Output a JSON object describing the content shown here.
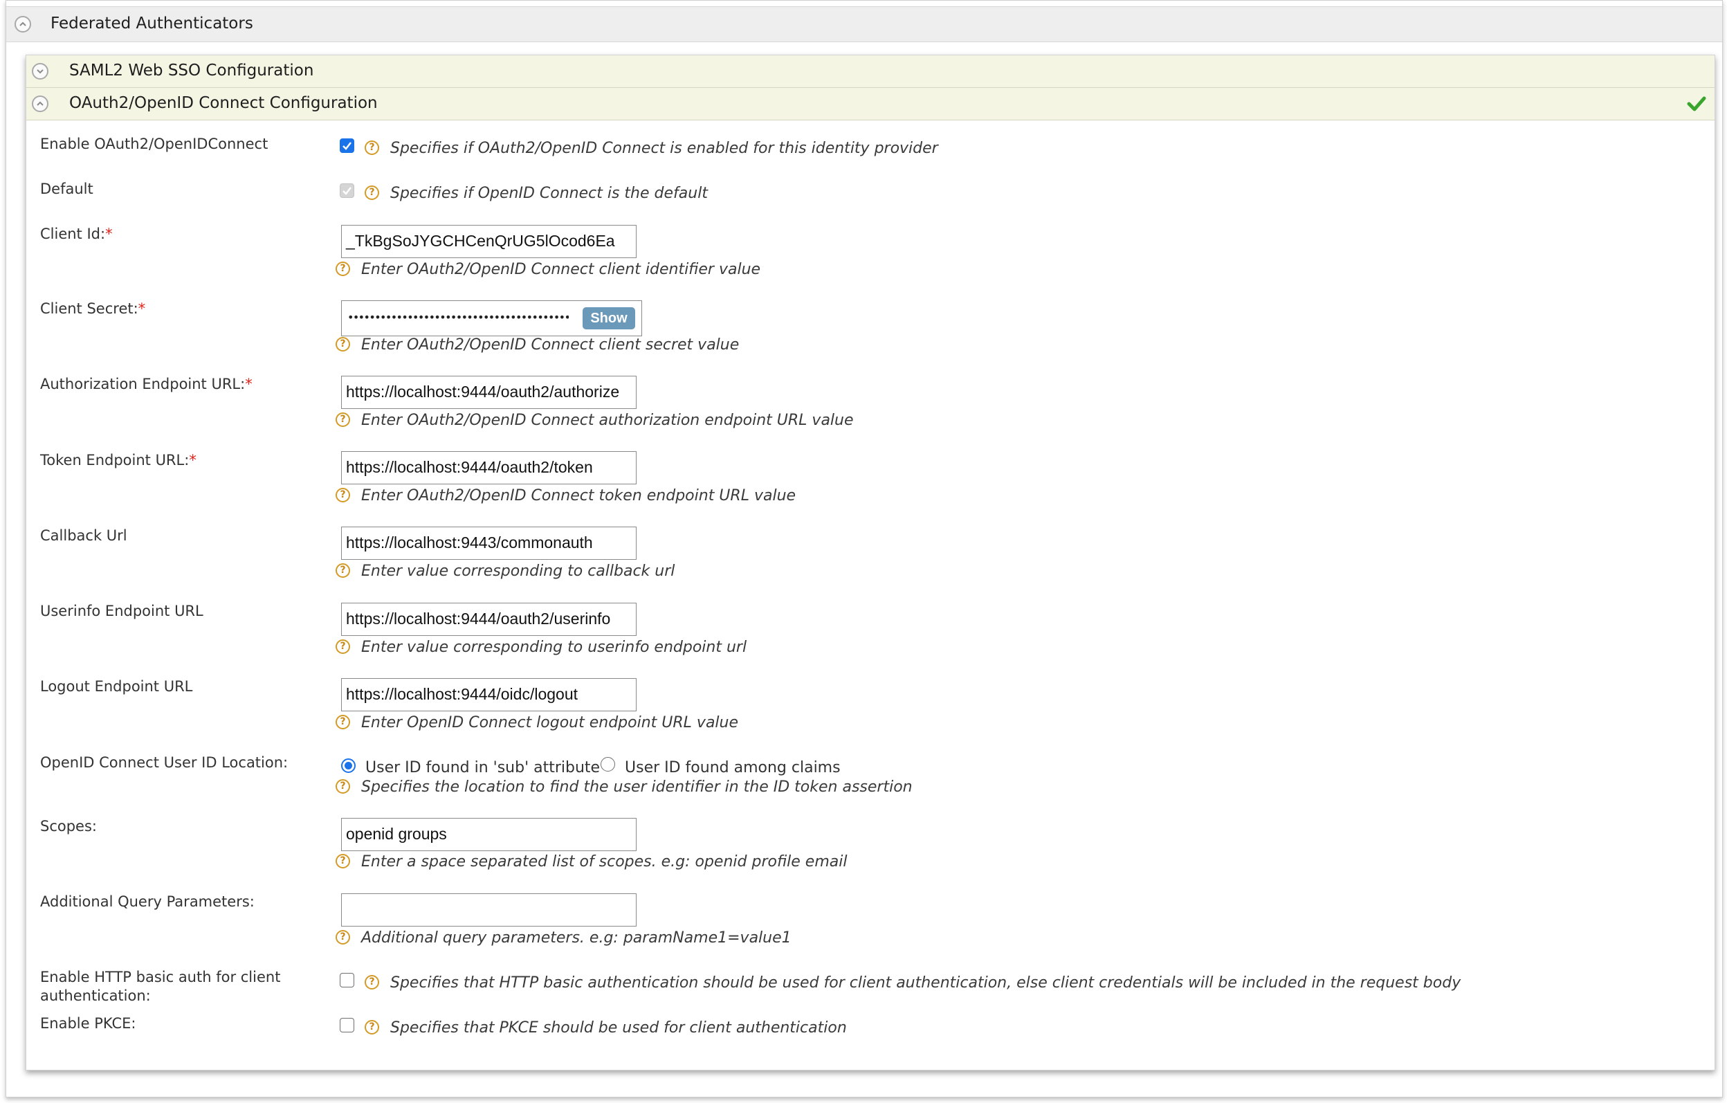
{
  "section": {
    "title": "Federated Authenticators"
  },
  "subsections": {
    "saml": {
      "title": "SAML2 Web SSO Configuration"
    },
    "oidc": {
      "title": "OAuth2/OpenID Connect Configuration"
    }
  },
  "fields": {
    "enable": {
      "label": "Enable OAuth2/OpenIDConnect",
      "checked": true,
      "help": "Specifies if OAuth2/OpenID Connect is enabled for this identity provider"
    },
    "default": {
      "label": "Default",
      "checked": true,
      "disabled": true,
      "help": "Specifies if OpenID Connect is the default"
    },
    "client_id": {
      "label": "Client Id:",
      "required": "*",
      "value": "_TkBgSoJYGCHCenQrUG5lOcod6Ea",
      "help": "Enter OAuth2/OpenID Connect client identifier value"
    },
    "client_secret": {
      "label": "Client Secret:",
      "required": "*",
      "value": "••••••••••••••••••••••••••••••••••••••••••••••••",
      "show_label": "Show",
      "help": "Enter OAuth2/OpenID Connect client secret value"
    },
    "auth_endpoint": {
      "label": "Authorization Endpoint URL:",
      "required": "*",
      "value": "https://localhost:9444/oauth2/authorize",
      "help": "Enter OAuth2/OpenID Connect authorization endpoint URL value"
    },
    "token_endpoint": {
      "label": "Token Endpoint URL:",
      "required": "*",
      "value": "https://localhost:9444/oauth2/token",
      "help": "Enter OAuth2/OpenID Connect token endpoint URL value"
    },
    "callback_url": {
      "label": "Callback Url",
      "value": "https://localhost:9443/commonauth",
      "help": "Enter value corresponding to callback url"
    },
    "userinfo_endpoint": {
      "label": "Userinfo Endpoint URL",
      "value": "https://localhost:9444/oauth2/userinfo",
      "help": "Enter value corresponding to userinfo endpoint url"
    },
    "logout_endpoint": {
      "label": "Logout Endpoint URL",
      "value": "https://localhost:9444/oidc/logout",
      "help": "Enter OpenID Connect logout endpoint URL value"
    },
    "user_id_location": {
      "label": "OpenID Connect User ID Location:",
      "options": [
        "User ID found in 'sub' attribute",
        "User ID found among claims"
      ],
      "selected": "User ID found in 'sub' attribute",
      "help": "Specifies the location to find the user identifier in the ID token assertion"
    },
    "scopes": {
      "label": "Scopes:",
      "value": "openid groups",
      "help": "Enter a space separated list of scopes. e.g: openid profile email"
    },
    "query_params": {
      "label": "Additional Query Parameters:",
      "value": "",
      "help": "Additional query parameters. e.g: paramName1=value1"
    },
    "basic_auth": {
      "label_line1": "Enable HTTP basic auth for client",
      "label_line2": "authentication:",
      "checked": false,
      "help": "Specifies that HTTP basic authentication should be used for client authentication, else client credentials will be included in the request body"
    },
    "pkce": {
      "label": "Enable PKCE:",
      "checked": false,
      "help": "Specifies that PKCE should be used for client authentication"
    }
  },
  "icons": {
    "collapse": "chevron-up-icon",
    "expand": "chevron-down-icon",
    "help": "help-icon",
    "valid": "check-icon"
  },
  "colors": {
    "accent": "#1a73e8",
    "required": "#e2231a",
    "help": "#d49a26",
    "valid": "#3aa52c",
    "subheader_bg": "#f4f5e3",
    "show_button": "#6b99b9"
  }
}
